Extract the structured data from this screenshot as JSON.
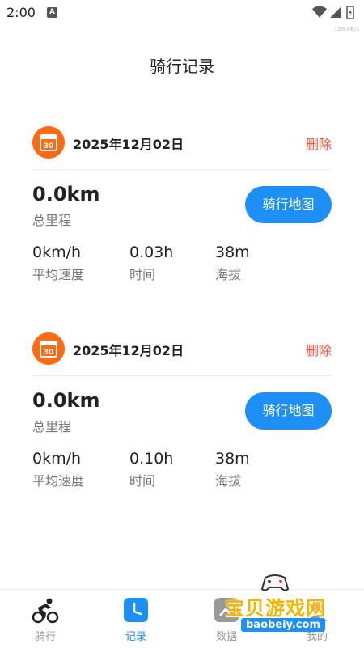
{
  "status": {
    "time": "2:00",
    "notification_icon": "A",
    "net_speed": "126.0B/s"
  },
  "page": {
    "title": "骑行记录"
  },
  "records": [
    {
      "date": "2025年12月02日",
      "delete_label": "删除",
      "distance": "0.0km",
      "distance_label": "总里程",
      "map_button": "骑行地图",
      "stats": [
        {
          "value": "0km/h",
          "label": "平均速度"
        },
        {
          "value": "0.03h",
          "label": "时间"
        },
        {
          "value": "38m",
          "label": "海拔"
        }
      ]
    },
    {
      "date": "2025年12月02日",
      "delete_label": "删除",
      "distance": "0.0km",
      "distance_label": "总里程",
      "map_button": "骑行地图",
      "stats": [
        {
          "value": "0km/h",
          "label": "平均速度"
        },
        {
          "value": "0.10h",
          "label": "时间"
        },
        {
          "value": "38m",
          "label": "海拔"
        }
      ]
    }
  ],
  "tabs": [
    {
      "label": "骑行",
      "icon": "cyclist-icon",
      "active": false
    },
    {
      "label": "记录",
      "icon": "clock-icon",
      "active": true
    },
    {
      "label": "数据",
      "icon": "chart-icon",
      "active": false
    },
    {
      "label": "我的",
      "icon": "user-icon",
      "active": false
    }
  ],
  "watermark": {
    "text": "宝贝游戏网",
    "url": "baobeiy.com"
  },
  "colors": {
    "accent": "#1e90f5",
    "orange": "#ff6a13",
    "delete": "#ee4b3e"
  }
}
